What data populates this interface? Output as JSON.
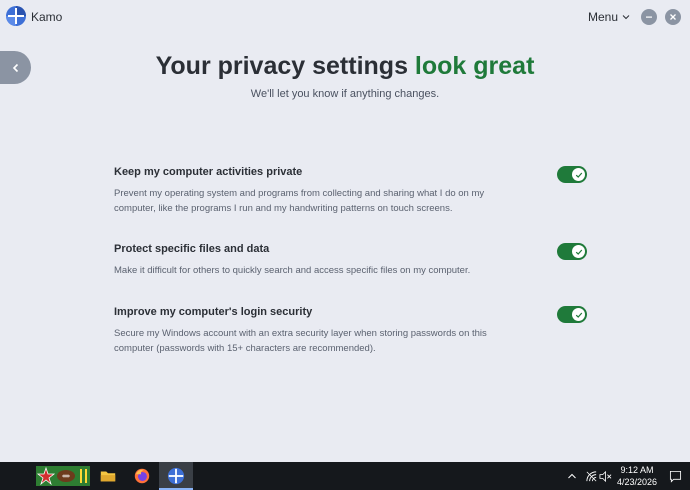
{
  "app": {
    "name": "Kamo",
    "menu_label": "Menu"
  },
  "header": {
    "headline_main": "Your privacy settings ",
    "headline_accent": "look great",
    "subtitle": "We'll let you know if anything changes."
  },
  "settings": [
    {
      "title": "Keep my computer activities private",
      "description": "Prevent my operating system and programs from collecting and sharing what I do on my computer, like the programs I run and my handwriting patterns on touch screens.",
      "enabled": true
    },
    {
      "title": "Protect specific files and data",
      "description": "Make it difficult for others to quickly search and access specific files on my computer.",
      "enabled": true
    },
    {
      "title": "Improve my computer's login security",
      "description": "Secure my Windows account with an extra security layer when storing passwords on this computer (passwords with 15+ characters are recommended).",
      "enabled": true
    }
  ],
  "taskbar": {
    "time": "9:12 AM",
    "date": "4/23/2026",
    "pinned_icons": [
      "game-icon",
      "file-explorer-icon",
      "firefox-icon",
      "kamo-icon"
    ],
    "tray_icons": [
      "chevron-up-icon",
      "network-icon",
      "volume-muted-icon",
      "notification-icon"
    ]
  },
  "colors": {
    "background": "#e9ebf2",
    "accent_green": "#1f7a3a",
    "text_dark": "#2b2f36",
    "text_muted": "#5b6270",
    "button_gray": "#8b94a3",
    "taskbar": "#15181c"
  }
}
